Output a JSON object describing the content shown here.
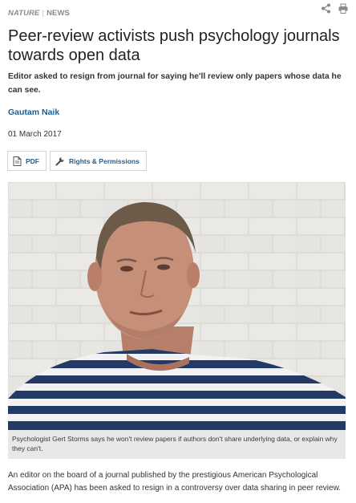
{
  "header": {
    "publication": "NATURE",
    "separator": "|",
    "section": "NEWS",
    "share_icon": "share-icon",
    "print_icon": "print-icon"
  },
  "article": {
    "title": "Peer-review activists push psychology journals towards open data",
    "standfirst": "Editor asked to resign from journal for saying he'll review only papers whose data he can see.",
    "author": "Gautam Naik",
    "date": "01 March 2017",
    "buttons": {
      "pdf_label": "PDF",
      "pdf_icon": "pdf-icon",
      "rights_label": "Rights & Permissions",
      "rights_icon": "wrench-icon"
    },
    "image": {
      "caption": "Psychologist Gert Storms says he won't review papers if authors don't share underlying data, or explain why they can't."
    },
    "body_first_paragraph": "An editor on the board of a journal published by the prestigious American Psychological Association (APA) has been asked to resign in a controversy over data sharing in peer review."
  },
  "colors": {
    "link_blue": "#1f5d8f",
    "kicker_grey": "#8a8a8a",
    "caption_bg": "#e8e8e8",
    "button_border": "#cfd5da"
  }
}
